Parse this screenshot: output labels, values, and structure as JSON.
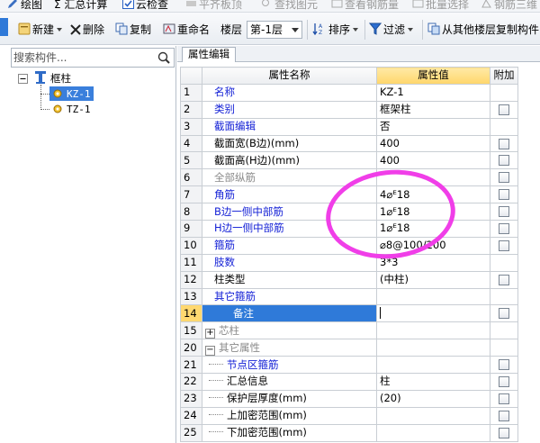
{
  "toolbar_top": {
    "items": [
      {
        "label": "绘图",
        "disabled": false
      },
      {
        "label": "Σ 汇总计算",
        "disabled": false
      },
      {
        "label": "云检查",
        "disabled": false
      },
      {
        "label": "平齐板顶",
        "disabled": true
      },
      {
        "label": "查找图元",
        "disabled": true
      },
      {
        "label": "查看钢筋量",
        "disabled": true
      },
      {
        "label": "批量选择",
        "disabled": true
      },
      {
        "label": "钢筋三维",
        "disabled": true
      }
    ]
  },
  "toolbar": {
    "new_label": "新建",
    "delete_label": "删除",
    "copy_label": "复制",
    "rename_label": "重命名",
    "floor_label": "楼层",
    "floor_value": "第-1层",
    "sort_label": "排序",
    "filter_label": "过滤",
    "copy_from_floor_label": "从其他楼层复制构件"
  },
  "left_panel": {
    "search_placeholder": "搜索构件...",
    "tree": {
      "root_label": "框柱",
      "children": [
        {
          "label": "KZ-1",
          "selected": true
        },
        {
          "label": "TZ-1",
          "selected": false
        }
      ]
    }
  },
  "property_panel": {
    "tab_label": "属性编辑",
    "headers": {
      "name": "属性名称",
      "value": "属性值",
      "extra": "附加"
    },
    "rows": [
      {
        "num": "1",
        "name": "名称",
        "value": "KZ-1",
        "style": "blue",
        "checkbox": false
      },
      {
        "num": "2",
        "name": "类别",
        "value": "框架柱",
        "style": "blue",
        "checkbox": true
      },
      {
        "num": "3",
        "name": "截面编辑",
        "value": "否",
        "style": "blue",
        "checkbox": false
      },
      {
        "num": "4",
        "name": "截面宽(B边)(mm)",
        "value": "400",
        "style": "black",
        "checkbox": true
      },
      {
        "num": "5",
        "name": "截面高(H边)(mm)",
        "value": "400",
        "style": "black",
        "checkbox": true
      },
      {
        "num": "6",
        "name": "全部纵筋",
        "value": "",
        "style": "gray",
        "checkbox": true
      },
      {
        "num": "7",
        "name": "角筋",
        "value": "4⌀ᴱ18",
        "style": "blue",
        "checkbox": true
      },
      {
        "num": "8",
        "name": "B边一侧中部筋",
        "value": "1⌀ᴱ18",
        "style": "blue",
        "checkbox": true
      },
      {
        "num": "9",
        "name": "H边一侧中部筋",
        "value": "1⌀ᴱ18",
        "style": "blue",
        "checkbox": true
      },
      {
        "num": "10",
        "name": "箍筋",
        "value": "⌀8@100/200",
        "style": "blue",
        "checkbox": true
      },
      {
        "num": "11",
        "name": "肢数",
        "value": "3*3",
        "style": "blue",
        "checkbox": false
      },
      {
        "num": "12",
        "name": "柱类型",
        "value": "(中柱)",
        "style": "black",
        "checkbox": true
      },
      {
        "num": "13",
        "name": "其它箍筋",
        "value": "",
        "style": "blue",
        "checkbox": false
      },
      {
        "num": "14",
        "name": "备注",
        "value": "",
        "style": "selected",
        "checkbox": true
      },
      {
        "num": "15",
        "name": "芯柱",
        "value": "",
        "style": "gray-expander-plus",
        "checkbox": false
      },
      {
        "num": "20",
        "name": "其它属性",
        "value": "",
        "style": "gray-expander-minus",
        "checkbox": false
      },
      {
        "num": "21",
        "name": "节点区箍筋",
        "value": "",
        "style": "blue-child",
        "checkbox": true
      },
      {
        "num": "22",
        "name": "汇总信息",
        "value": "柱",
        "style": "black-child",
        "checkbox": true
      },
      {
        "num": "23",
        "name": "保护层厚度(mm)",
        "value": "(20)",
        "style": "black-child",
        "checkbox": true
      },
      {
        "num": "24",
        "name": "上加密范围(mm)",
        "value": "",
        "style": "black-child",
        "checkbox": true
      },
      {
        "num": "25",
        "name": "下加密范围(mm)",
        "value": "",
        "style": "black-child",
        "checkbox": true
      }
    ]
  },
  "colors": {
    "accent_blue": "#2f7ad9",
    "header_highlight": "#ffd66b",
    "annotation_magenta": "#f03ee8",
    "label_blue": "#1421d6"
  }
}
